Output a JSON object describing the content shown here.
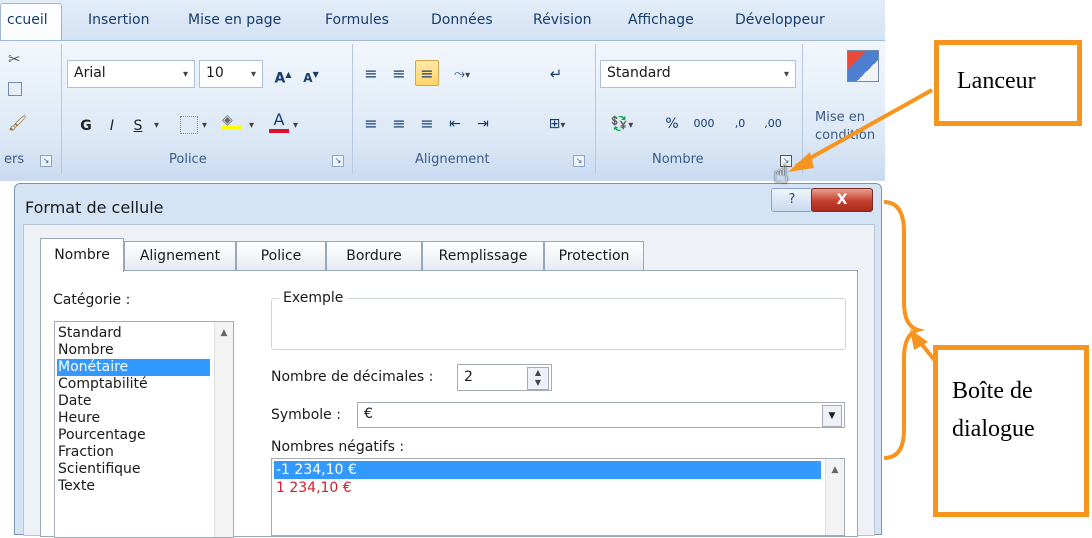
{
  "ribbon": {
    "tabs": [
      "ccueil",
      "Insertion",
      "Mise en page",
      "Formules",
      "Données",
      "Révision",
      "Affichage",
      "Développeur"
    ],
    "font": {
      "name": "Arial",
      "size": "10",
      "grow_label": "A",
      "shrink_label": "A",
      "bold_label": "G",
      "italic_label": "I",
      "underline_label": "S",
      "font_color_label": "A"
    },
    "groups": {
      "clipboard_label": "ers",
      "police_label": "Police",
      "alignment_label": "Alignement",
      "number_label": "Nombre"
    },
    "number": {
      "format": "Standard",
      "percent_label": "%",
      "thousands_label": "000",
      "inc_dec_label": ",0",
      "dec_dec_label": ",00"
    },
    "styles_label_line1": "Mise en",
    "styles_label_line2": "condition"
  },
  "dialog": {
    "title": "Format de cellule",
    "help_label": "?",
    "close_label": "X",
    "tabs": [
      "Nombre",
      "Alignement",
      "Police",
      "Bordure",
      "Remplissage",
      "Protection"
    ],
    "category_label": "Catégorie :",
    "categories": [
      "Standard",
      "Nombre",
      "Monétaire",
      "Comptabilité",
      "Date",
      "Heure",
      "Pourcentage",
      "Fraction",
      "Scientifique",
      "Texte"
    ],
    "selected_category": "Monétaire",
    "example_label": "Exemple",
    "decimals_label": "Nombre de décimales :",
    "decimals_value": "2",
    "symbol_label": "Symbole :",
    "symbol_value": "€",
    "negative_label": "Nombres négatifs :",
    "negative_items": [
      "-1 234,10 €",
      "1 234,10 €"
    ]
  },
  "annotations": {
    "launcher": "Lanceur",
    "dialog_box_line1": "Boîte de",
    "dialog_box_line2": "dialogue"
  },
  "colors": {
    "accent": "#f7941d",
    "selection": "#3399ff",
    "negative_red": "#d0202b"
  }
}
